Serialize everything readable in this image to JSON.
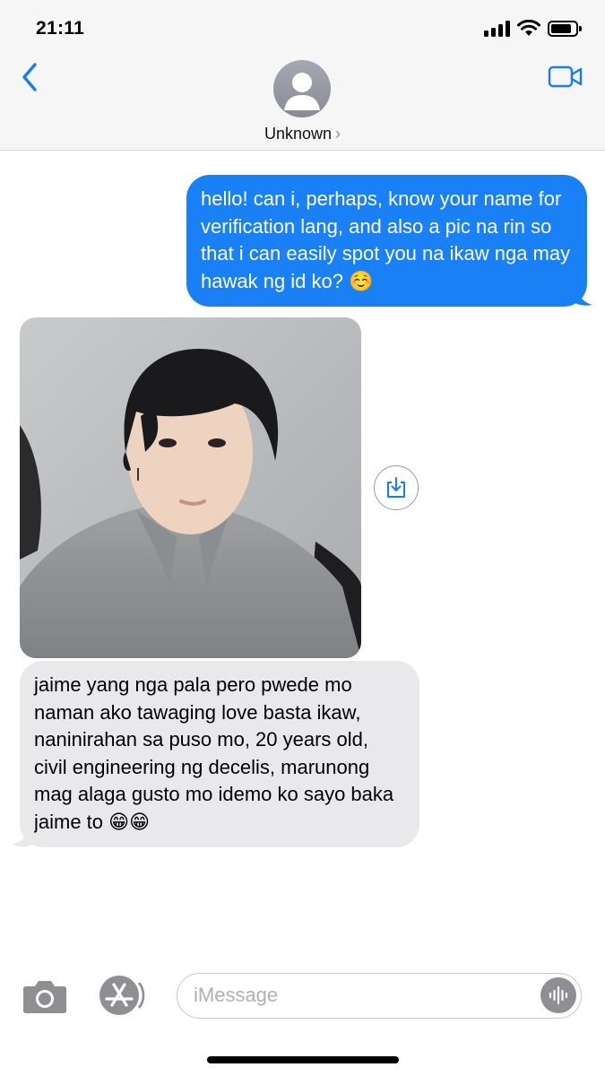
{
  "status_bar": {
    "time": "21:11",
    "icons": [
      "signal-icon",
      "wifi-icon",
      "battery-icon"
    ],
    "battery_level": 0.85
  },
  "header": {
    "back_icon": "chevron-left-icon",
    "contact_name": "Unknown",
    "contact_chevron": "›",
    "avatar_icon": "person-silhouette-icon",
    "video_icon": "facetime-video-icon"
  },
  "messages": [
    {
      "direction": "outgoing",
      "text": "hello! can i, perhaps, know your name for verification lang, and also a pic na rin so that i can easily spot you na ikaw nga may hawak ng id ko? ☺️"
    },
    {
      "direction": "incoming",
      "type": "photo",
      "save_icon": "save-to-photos-icon"
    },
    {
      "direction": "incoming",
      "text": "jaime yang nga pala pero pwede mo naman ako tawaging love basta ikaw, naninirahan sa puso mo, 20 years old, civil engineering ng decelis, marunong mag alaga gusto mo idemo ko sayo baka jaime to 😁😁"
    }
  ],
  "composer": {
    "placeholder": "iMessage",
    "camera_icon": "camera-icon",
    "apps_icon": "app-store-icon",
    "voice_icon": "voice-waveform-icon"
  },
  "colors": {
    "outgoing_bubble": "#1a80f6",
    "incoming_bubble": "#e9e9eb",
    "accent": "#1a7cf5",
    "header_bg": "#f6f6f7"
  }
}
